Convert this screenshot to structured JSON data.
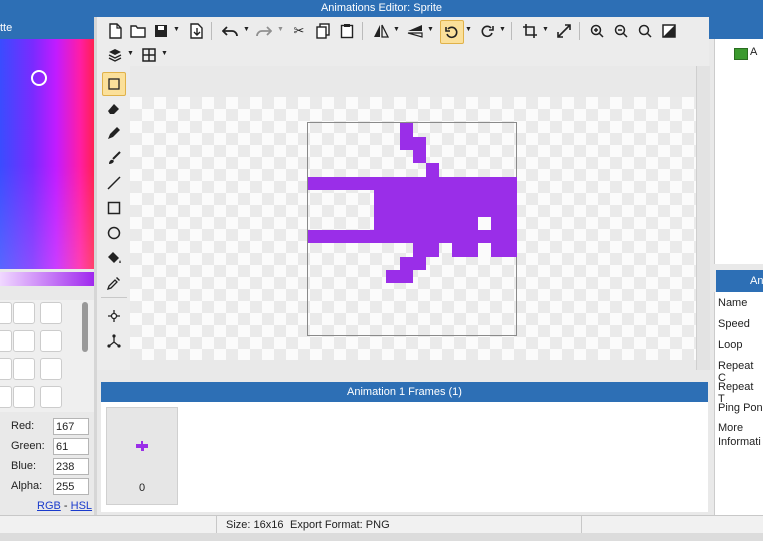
{
  "window": {
    "title": "Animations Editor: Sprite"
  },
  "palette": {
    "header": "tte",
    "rgb": [
      {
        "label": "Red:",
        "value": "167"
      },
      {
        "label": "Green:",
        "value": "61"
      },
      {
        "label": "Blue:",
        "value": "238"
      },
      {
        "label": "Alpha:",
        "value": "255"
      }
    ],
    "mode_rgb": "RGB",
    "mode_sep": " - ",
    "mode_hsl": "HSL"
  },
  "frames": {
    "header": "Animation 1 Frames (1)",
    "items": [
      {
        "index": "0"
      }
    ]
  },
  "right_panel": {
    "tree_item": "A",
    "header": "Ani",
    "properties": [
      "Name",
      "Speed",
      "Loop",
      "Repeat C",
      "Repeat T",
      "Ping Pon",
      "More",
      "Informati"
    ]
  },
  "status": {
    "size": "Size: 16x16",
    "export": "Export Format: PNG"
  },
  "colors": {
    "accent": "#2d6fb5",
    "sprite": "#9a2ee8",
    "selected_tool": "#fbe09a"
  },
  "icons": {
    "toolbar": [
      "new-file-icon",
      "open-folder-icon",
      "save-icon",
      "export-icon",
      "undo-icon",
      "redo-icon",
      "cut-icon",
      "copy-icon",
      "paste-icon",
      "flip-horizontal-icon",
      "flip-vertical-icon",
      "rotate-ccw-icon",
      "rotate-cw-icon",
      "crop-icon",
      "resize-icon",
      "zoom-in-icon",
      "zoom-out-icon",
      "zoom-fit-icon",
      "toggle-grid-icon",
      "layers-icon",
      "grid-icon"
    ],
    "tools": [
      "select-icon",
      "eraser-icon",
      "pencil-icon",
      "brush-icon",
      "line-icon",
      "rectangle-icon",
      "ellipse-icon",
      "fill-icon",
      "eyedropper-icon",
      "sparkle-icon",
      "nodes-icon"
    ]
  }
}
